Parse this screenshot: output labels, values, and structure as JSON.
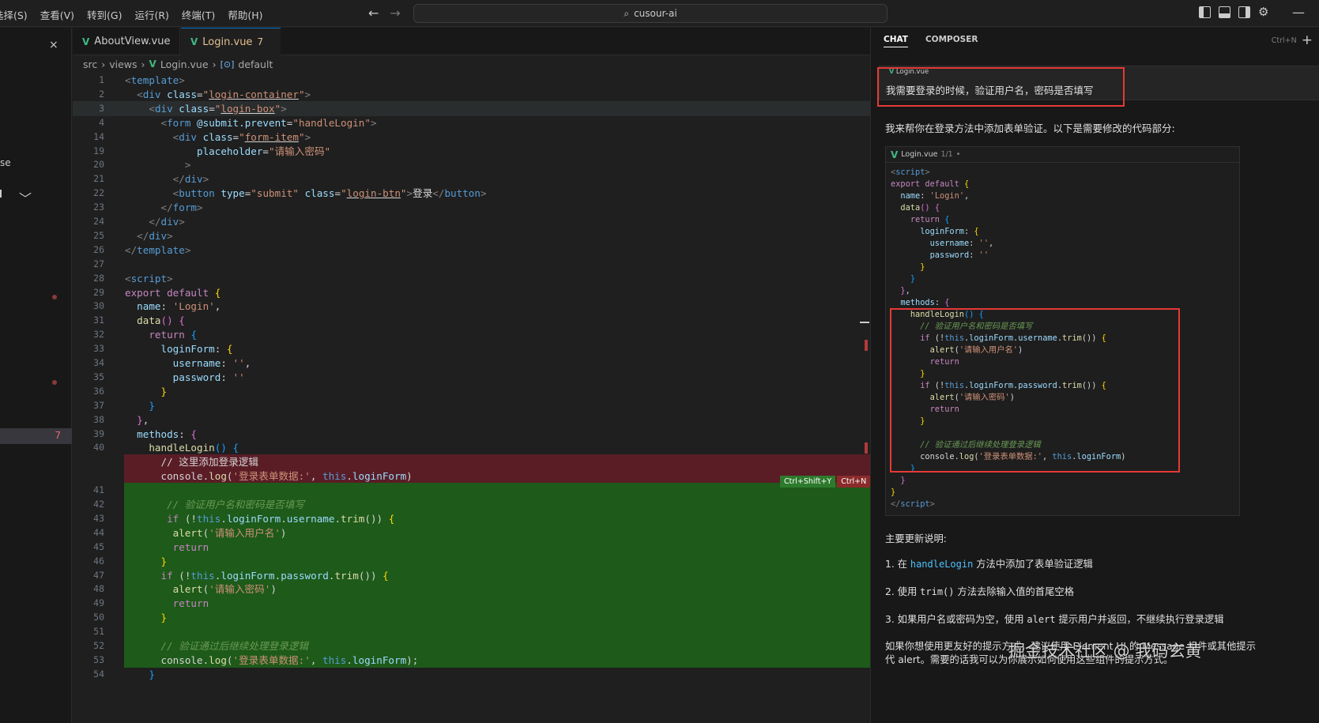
{
  "menu": [
    "选择(S)",
    "查看(V)",
    "转到(G)",
    "运行(R)",
    "终端(T)",
    "帮助(H)"
  ],
  "search": {
    "label": "cusour-ai"
  },
  "sidebar": {
    "clip_text": "se",
    "badge": "7"
  },
  "tabs": [
    {
      "label": "AboutView.vue"
    },
    {
      "label": "Login.vue",
      "badge": "7"
    }
  ],
  "breadcrumb": [
    "src",
    "views",
    "Login.vue",
    "default"
  ],
  "editor": {
    "lines": [
      {
        "n": "1",
        "html": "<span class=\"tg\">&lt;</span><span class=\"tn\">template</span><span class=\"tg\">&gt;</span>"
      },
      {
        "n": "2",
        "html": "  <span class=\"tg\">&lt;</span><span class=\"tn\">div</span> <span class=\"at\">class</span>=<span class=\"av\">\"<span class=\"ul\">login-container</span>\"</span><span class=\"tg\">&gt;</span>"
      },
      {
        "n": "3",
        "cur": true,
        "html": "    <span class=\"tg\">&lt;</span><span class=\"tn\">div</span> <span class=\"at\">class</span>=<span class=\"av\">\"<span class=\"ul\">login-box</span>\"</span><span class=\"tg\">&gt;</span>"
      },
      {
        "n": "4",
        "html": "      <span class=\"tg\">&lt;</span><span class=\"tn\">form</span> <span class=\"at\">@submit.prevent</span>=<span class=\"av\">\"handleLogin\"</span><span class=\"tg\">&gt;</span>"
      },
      {
        "n": "14",
        "html": "        <span class=\"tg\">&lt;</span><span class=\"tn\">div</span> <span class=\"at\">class</span>=<span class=\"av\">\"<span class=\"ul\">form-item</span>\"</span><span class=\"tg\">&gt;</span>"
      },
      {
        "n": "19",
        "html": "            <span class=\"at\">placeholder</span>=<span class=\"av\">\"请输入密码\"</span>"
      },
      {
        "n": "20",
        "html": "          <span class=\"tg\">&gt;</span>"
      },
      {
        "n": "21",
        "html": "        <span class=\"tg\">&lt;/</span><span class=\"tn\">div</span><span class=\"tg\">&gt;</span>"
      },
      {
        "n": "22",
        "html": "        <span class=\"tg\">&lt;</span><span class=\"tn\">button</span> <span class=\"at\">type</span>=<span class=\"av\">\"submit\"</span> <span class=\"at\">class</span>=<span class=\"av\">\"<span class=\"ul\">login-btn</span>\"</span><span class=\"tg\">&gt;</span>登录<span class=\"tg\">&lt;/</span><span class=\"tn\">button</span><span class=\"tg\">&gt;</span>"
      },
      {
        "n": "23",
        "html": "      <span class=\"tg\">&lt;/</span><span class=\"tn\">form</span><span class=\"tg\">&gt;</span>"
      },
      {
        "n": "24",
        "html": "    <span class=\"tg\">&lt;/</span><span class=\"tn\">div</span><span class=\"tg\">&gt;</span>"
      },
      {
        "n": "25",
        "html": "  <span class=\"tg\">&lt;/</span><span class=\"tn\">div</span><span class=\"tg\">&gt;</span>"
      },
      {
        "n": "26",
        "html": "<span class=\"tg\">&lt;/</span><span class=\"tn\">template</span><span class=\"tg\">&gt;</span>"
      },
      {
        "n": "27",
        "html": ""
      },
      {
        "n": "28",
        "html": "<span class=\"tg\">&lt;</span><span class=\"tn\">script</span><span class=\"tg\">&gt;</span>"
      },
      {
        "n": "29",
        "html": "<span class=\"kw\">export</span> <span class=\"kw\">default</span> <span class=\"br\">{</span>"
      },
      {
        "n": "30",
        "html": "  <span class=\"pr\">name</span>: <span class=\"st\">'Login'</span>,"
      },
      {
        "n": "31",
        "html": "  <span class=\"fn\">data</span><span class=\"br2\">()</span> <span class=\"br2\">{</span>"
      },
      {
        "n": "32",
        "html": "    <span class=\"kw\">return</span> <span class=\"br3\">{</span>"
      },
      {
        "n": "33",
        "html": "      <span class=\"pr\">loginForm</span>: <span class=\"br\">{</span>"
      },
      {
        "n": "34",
        "html": "        <span class=\"pr\">username</span>: <span class=\"st\">''</span>,"
      },
      {
        "n": "35",
        "html": "        <span class=\"pr\">password</span>: <span class=\"st\">''</span>"
      },
      {
        "n": "36",
        "html": "      <span class=\"br\">}</span>"
      },
      {
        "n": "37",
        "html": "    <span class=\"br3\">}</span>"
      },
      {
        "n": "38",
        "html": "  <span class=\"br2\">}</span>,"
      },
      {
        "n": "39",
        "html": "  <span class=\"pr\">methods</span>: <span class=\"br2\">{</span>"
      },
      {
        "n": "40",
        "html": "    <span class=\"fn\">handleLogin</span><span class=\"br3\">()</span> <span class=\"br3\">{</span>"
      },
      {
        "n": "",
        "del": true,
        "html": "      <span class=\"cm\" style=\"font-style:normal;color:#d4d4d4\">// 这里添加登录逻辑</span>"
      },
      {
        "n": "",
        "del": true,
        "html": "      console.<span class=\"fn\">log</span>(<span class=\"st\">'登录表单数据:'</span>, <span class=\"kb\">this</span>.<span class=\"pr\">loginForm</span>)"
      },
      {
        "n": "41",
        "add": true,
        "html": ""
      },
      {
        "n": "42",
        "add": true,
        "html": "       <span class=\"cm\">// 验证用户名和密码是否填写</span>"
      },
      {
        "n": "43",
        "add": true,
        "html": "       <span class=\"kw\">if</span> (!<span class=\"kb\">this</span>.<span class=\"pr\">loginForm</span>.<span class=\"pr\">username</span>.<span class=\"fn\">trim</span>()) <span class=\"br\">{</span>"
      },
      {
        "n": "44",
        "add": true,
        "html": "        <span class=\"fn\">alert</span>(<span class=\"st\">'请输入用户名'</span>)"
      },
      {
        "n": "45",
        "add": true,
        "html": "        <span class=\"kw\">return</span>"
      },
      {
        "n": "46",
        "add": true,
        "html": "      <span class=\"br\">}</span>"
      },
      {
        "n": "47",
        "add": true,
        "html": "      <span class=\"kw\">if</span> (!<span class=\"kb\">this</span>.<span class=\"pr\">loginForm</span>.<span class=\"pr\">password</span>.<span class=\"fn\">trim</span>()) <span class=\"br\">{</span>"
      },
      {
        "n": "48",
        "add": true,
        "html": "        <span class=\"fn\">alert</span>(<span class=\"st\">'请输入密码'</span>)"
      },
      {
        "n": "49",
        "add": true,
        "html": "        <span class=\"kw\">return</span>"
      },
      {
        "n": "50",
        "add": true,
        "html": "      <span class=\"br\">}</span>"
      },
      {
        "n": "51",
        "add": true,
        "html": ""
      },
      {
        "n": "52",
        "add": true,
        "html": "      <span class=\"cm\">// 验证通过后继续处理登录逻辑</span>"
      },
      {
        "n": "53",
        "add": true,
        "html": "      console.<span class=\"fn\">log</span>(<span class=\"st\">'登录表单数据:'</span>, <span class=\"kb\">this</span>.<span class=\"pr\">loginForm</span>);"
      },
      {
        "n": "54",
        "html": "    <span class=\"br3\">}</span>"
      }
    ],
    "accept_label": "Ctrl+Shift+Y",
    "reject_label": "Ctrl+N"
  },
  "chat": {
    "tabs": [
      "CHAT",
      "COMPOSER"
    ],
    "shortcut": "Ctrl+N",
    "user_file_chip": "Login.vue",
    "user_message": "我需要登录的时候，验证用户名，密码是否填写",
    "reply_intro": "我来帮你在登录方法中添加表单验证。以下是需要修改的代码部分:",
    "codeblock": {
      "file": "Login.vue",
      "count": "1/1",
      "lines": [
        "<span class=\"tg\">&lt;</span><span class=\"tn\">script</span><span class=\"tg\">&gt;</span>",
        "<span class=\"kw\">export</span> <span class=\"kw\">default</span> <span class=\"br\">{</span>",
        "  <span class=\"pr\">name</span>: <span class=\"st\">'Login'</span>,",
        "  <span class=\"fn\">data</span><span class=\"br2\">()</span> <span class=\"br2\">{</span>",
        "    <span class=\"kw\">return</span> <span class=\"br3\">{</span>",
        "      <span class=\"pr\">loginForm</span>: <span class=\"br\">{</span>",
        "        <span class=\"pr\">username</span>: <span class=\"st\">''</span>,",
        "        <span class=\"pr\">password</span>: <span class=\"st\">''</span>",
        "      <span class=\"br\">}</span>",
        "    <span class=\"br3\">}</span>",
        "  <span class=\"br2\">}</span>,",
        "  <span class=\"pr\">methods</span>: <span class=\"br2\">{</span>",
        "    <span class=\"fn\">handleLogin</span><span class=\"br3\">()</span> <span class=\"br3\">{</span>",
        "      <span class=\"cm\">// 验证用户名和密码是否填写</span>",
        "      <span class=\"kw\">if</span> (!<span class=\"kb\">this</span>.<span class=\"pr\">loginForm</span>.<span class=\"pr\">username</span>.<span class=\"fn\">trim</span>()) <span class=\"br\">{</span>",
        "        <span class=\"fn\">alert</span>(<span class=\"st\">'请输入用户名'</span>)",
        "        <span class=\"kw\">return</span>",
        "      <span class=\"br\">}</span>",
        "      <span class=\"kw\">if</span> (!<span class=\"kb\">this</span>.<span class=\"pr\">loginForm</span>.<span class=\"pr\">password</span>.<span class=\"fn\">trim</span>()) <span class=\"br\">{</span>",
        "        <span class=\"fn\">alert</span>(<span class=\"st\">'请输入密码'</span>)",
        "        <span class=\"kw\">return</span>",
        "      <span class=\"br\">}</span>",
        "",
        "      <span class=\"cm\">// 验证通过后继续处理登录逻辑</span>",
        "      console.<span class=\"fn\">log</span>(<span class=\"st\">'登录表单数据:'</span>, <span class=\"kb\">this</span>.<span class=\"pr\">loginForm</span>)",
        "    <span class=\"br3\">}</span>",
        "  <span class=\"br2\">}</span>",
        "<span class=\"br\">}</span>",
        "<span class=\"tg\">&lt;/</span><span class=\"tn\">script</span><span class=\"tg\">&gt;</span>"
      ]
    },
    "notes_title": "主要更新说明:",
    "note1_pre": "1. 在 ",
    "note1_code": "handleLogin",
    "note1_post": " 方法中添加了表单验证逻辑",
    "note2_pre": "2. 使用 ",
    "note2_code": "trim()",
    "note2_post": " 方法去除输入值的首尾空格",
    "note3_pre": "3. 如果用户名或密码为空，使用 ",
    "note3_code": "alert",
    "note3_post": " 提示用户并返回，不继续执行登录逻辑",
    "note4_line1": "如果你想使用更友好的提示方式，建议使用 Element UI 的 Message 组件或其他提示",
    "note4_line2": "代 alert。需要的话我可以为你展示如何使用这些组件的提示方式。"
  },
  "watermark": "掘金技术社区 @ 我码玄黄",
  "colors": {
    "accent": "#0078d4",
    "added": "#1e5a1a",
    "removed": "#5a1d26",
    "highlight_box": "#e53935"
  }
}
